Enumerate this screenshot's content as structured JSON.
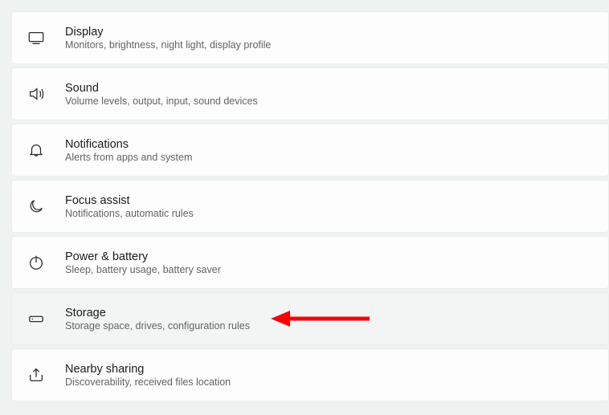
{
  "settings": {
    "items": [
      {
        "key": "display",
        "title": "Display",
        "desc": "Monitors, brightness, night light, display profile"
      },
      {
        "key": "sound",
        "title": "Sound",
        "desc": "Volume levels, output, input, sound devices"
      },
      {
        "key": "notifications",
        "title": "Notifications",
        "desc": "Alerts from apps and system"
      },
      {
        "key": "focus-assist",
        "title": "Focus assist",
        "desc": "Notifications, automatic rules"
      },
      {
        "key": "power-battery",
        "title": "Power & battery",
        "desc": "Sleep, battery usage, battery saver"
      },
      {
        "key": "storage",
        "title": "Storage",
        "desc": "Storage space, drives, configuration rules"
      },
      {
        "key": "nearby-sharing",
        "title": "Nearby sharing",
        "desc": "Discoverability, received files location"
      }
    ]
  },
  "annotation": {
    "arrow_points_to": "storage"
  }
}
